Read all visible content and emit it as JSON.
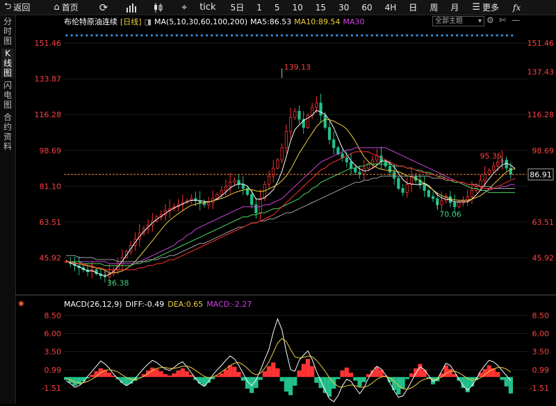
{
  "toolbar": {
    "back_label": "返回",
    "home_label": "首页",
    "tick_label": "tick",
    "periods": [
      "5日",
      "1",
      "5",
      "10",
      "15",
      "30",
      "60",
      "4H",
      "日",
      "周",
      "月"
    ],
    "more_label": "更多",
    "fx_label": "fx"
  },
  "sidebar": {
    "tabs": [
      "分时图",
      "K线图",
      "闪电图",
      "合约资料"
    ],
    "active": "K线图"
  },
  "header": {
    "instrument": "布伦特原油连续",
    "period": "[日线]",
    "ma_params": "MA(5,10,30,60,100,200)",
    "ma5": "MA5:86.53",
    "ma10": "MA10:89.54",
    "ma30": "MA30",
    "theme": "全部主题"
  },
  "macd_header": {
    "params": "MACD(26,12,9)",
    "diff": "DIFF:-0.49",
    "dea": "DEA:0.65",
    "macd": "MACD:-2.27"
  },
  "colors": {
    "up": "#ff3333",
    "down": "#22c08a",
    "ma5": "#ffffff",
    "ma10": "#f0d040",
    "ma30": "#cc44dd",
    "ma60": "#4cd964",
    "ma100": "#a0a0a0",
    "ma200": "#ff3030",
    "axis_text": "#ff4040",
    "label_red": "#ff4040",
    "label_green": "#3bd27a",
    "current_price_line": "#ff8a30"
  },
  "chart_data": [
    {
      "type": "line",
      "title": "布伦特原油连续",
      "subtitle": "日线",
      "y_ticks": [
        151.46,
        133.87,
        116.28,
        98.69,
        81.1,
        63.51,
        45.92
      ],
      "ylim": [
        30,
        158
      ],
      "right_axis_labels": [
        "151.46",
        "137.43",
        "116.28",
        "98.69",
        "86.91",
        "63.51",
        "45.92"
      ],
      "current_price": 86.91,
      "annotations": [
        {
          "text": "139.13",
          "value": 139.13,
          "kind": "high"
        },
        {
          "text": "36.38",
          "value": 36.38,
          "kind": "low"
        },
        {
          "text": "70.06",
          "value": 70.06,
          "kind": "low"
        },
        {
          "text": "95.35",
          "value": 95.35,
          "kind": "high"
        }
      ],
      "close_series": [
        44,
        43,
        42,
        41,
        40,
        39,
        40,
        38,
        37,
        36.5,
        38,
        40,
        43,
        46,
        49,
        52,
        55,
        58,
        60,
        62,
        64,
        66,
        67,
        69,
        70,
        71,
        72,
        73,
        74,
        75,
        74,
        73,
        72,
        73,
        75,
        77,
        79,
        81,
        83,
        84,
        82,
        80,
        77,
        72,
        68,
        75,
        82,
        86,
        90,
        94,
        100,
        108,
        115,
        118,
        114,
        110,
        116,
        120,
        122,
        116,
        110,
        104,
        100,
        97,
        95,
        93,
        90,
        88,
        87,
        90,
        92,
        94,
        96,
        93,
        91,
        88,
        85,
        80,
        78,
        82,
        86,
        84,
        82,
        79,
        76,
        75,
        72,
        74,
        76,
        73,
        71,
        73,
        74,
        76,
        79,
        81,
        84,
        87,
        89,
        91,
        93,
        94,
        90,
        87
      ],
      "ma_series": [
        {
          "name": "MA5",
          "values": [
            44.4,
            43.4,
            42.4,
            41.4,
            40.4,
            39.4,
            39.6,
            38.6,
            37.6,
            37.1,
            37.6,
            39.2,
            41.5,
            44.2,
            47.3,
            50.4,
            53.4,
            56.4,
            58.8,
            61,
            63,
            64.8,
            66.2,
            67.8,
            69.2,
            70.4,
            71.4,
            72.4,
            73.4,
            74.2,
            74.2,
            74,
            73.6,
            73.4,
            73.8,
            75,
            76.4,
            78.2,
            80.2,
            81.6,
            82.2,
            82.2,
            81.2,
            78.4,
            74.8,
            74.6,
            75.6,
            77.2,
            79.4,
            83.4,
            88.4,
            95.6,
            103.4,
            109,
            111.2,
            113.4,
            114.6,
            116,
            118.4,
            117.6,
            116.4,
            113.6,
            109.8,
            104.8,
            99.8,
            96.6,
            93.6,
            91.4,
            89.6,
            88.6,
            88.8,
            90,
            91.4,
            93.4,
            93.6,
            92.4,
            90.6,
            87.4,
            84.4,
            82.6,
            82.2,
            82,
            81.8,
            82.6,
            81.4,
            79.2,
            76.8,
            75.4,
            74.6,
            74.4,
            73.4,
            73.4,
            73.4,
            73.4,
            74.8,
            76.8,
            79.2,
            82,
            84.8,
            87.4,
            89.6,
            91.6,
            92.4,
            91.4,
            89.8
          ]
        },
        {
          "name": "MA10",
          "values": [
            44.4,
            43.9,
            43.4,
            42.9,
            42.4,
            41.9,
            41.4,
            40.9,
            40.4,
            39.8,
            38.5,
            38.6,
            38.8,
            39.4,
            40.6,
            42.1,
            44.1,
            46.5,
            49.1,
            51.7,
            54.3,
            57,
            59.7,
            62.3,
            64.4,
            66,
            67.6,
            69.1,
            70.5,
            71.7,
            72.3,
            72.7,
            73.1,
            73.4,
            73.9,
            74.5,
            75.1,
            75.8,
            76.9,
            77.9,
            78.6,
            79.2,
            79.6,
            79.4,
            78.8,
            78.5,
            78.8,
            79.8,
            80.9,
            82,
            83.8,
            86.1,
            89.3,
            93.3,
            97.3,
            100.6,
            104.1,
            107.2,
            110.4,
            112.6,
            114,
            113.8,
            113.1,
            112,
            110.9,
            109.2,
            106.4,
            103.2,
            99.2,
            95.6,
            93.3,
            91.6,
            90.2,
            89.4,
            89,
            88.9,
            88.6,
            88.2,
            87.4,
            86.2,
            85.7,
            84.9,
            83.9,
            82.3,
            80.8,
            79.3,
            77.6,
            76.5,
            75.7,
            74.9,
            74.4,
            74.2,
            74.2,
            74.3,
            74.7,
            75.5,
            76.5,
            78,
            79.8,
            82,
            84.1,
            86.2,
            88.2,
            89.3,
            89.6
          ]
        },
        {
          "name": "MA30",
          "values": [
            44,
            44,
            44,
            44,
            44,
            44,
            44,
            44,
            44,
            44,
            43,
            43,
            43,
            43,
            43,
            43,
            43,
            44,
            45,
            46,
            47,
            48,
            49,
            50,
            51,
            52,
            54,
            55,
            57,
            58,
            60,
            61,
            62,
            63,
            64,
            65,
            66,
            67,
            68,
            69,
            70,
            71,
            71,
            71,
            71,
            71,
            72,
            72,
            73,
            74,
            75,
            77,
            79,
            81,
            83,
            85,
            87,
            89,
            91,
            93,
            94,
            95,
            96,
            97,
            98,
            99,
            99,
            100,
            100,
            100,
            100,
            100,
            100,
            100,
            100,
            99,
            98,
            97,
            96,
            95,
            94,
            93,
            92,
            91,
            90,
            89,
            88,
            87,
            86,
            85,
            84,
            83,
            82,
            81,
            80,
            80,
            79,
            79,
            79,
            80,
            80,
            81,
            81,
            82,
            82
          ]
        },
        {
          "name": "MA60",
          "values": [
            44,
            44,
            44,
            44,
            43,
            43,
            43,
            43,
            43,
            42,
            42,
            42,
            42,
            42,
            42,
            42,
            43,
            43,
            44,
            44,
            45,
            46,
            47,
            48,
            49,
            50,
            51,
            52,
            53,
            54,
            55,
            56,
            57,
            58,
            59,
            60,
            61,
            62,
            63,
            64,
            65,
            66,
            66,
            67,
            67,
            68,
            68,
            69,
            70,
            70,
            71,
            72,
            73,
            74,
            75,
            77,
            78,
            80,
            81,
            83,
            84,
            85,
            86,
            87,
            88,
            89,
            90,
            90,
            91,
            91,
            92,
            92,
            92,
            92,
            92,
            92,
            91,
            91,
            91,
            90,
            90,
            89,
            89,
            88,
            88,
            87,
            86,
            86,
            85,
            84,
            83,
            83,
            82,
            81,
            80,
            80,
            79,
            79,
            78,
            78,
            78,
            78,
            78,
            78,
            78
          ]
        },
        {
          "name": "MA100",
          "values": [
            47,
            47,
            47,
            46,
            46,
            46,
            46,
            45,
            45,
            45,
            45,
            45,
            44,
            44,
            44,
            44,
            44,
            44,
            44,
            45,
            45,
            45,
            46,
            46,
            47,
            47,
            48,
            49,
            50,
            51,
            52,
            53,
            53,
            54,
            55,
            56,
            57,
            58,
            59,
            60,
            61,
            61,
            62,
            63,
            63,
            64,
            64,
            65,
            65,
            66,
            67,
            68,
            68,
            69,
            70,
            71,
            72,
            73,
            74,
            75,
            76,
            77,
            78,
            79,
            80,
            81,
            82,
            83,
            83,
            84,
            84,
            85,
            85,
            86,
            86,
            86,
            86,
            86,
            86,
            86,
            86,
            86,
            86,
            86,
            86,
            85,
            85,
            85,
            84,
            84,
            84,
            83,
            83,
            82,
            82,
            82,
            81,
            81,
            81,
            80,
            80,
            80,
            80,
            80,
            80
          ]
        },
        {
          "name": "MA200",
          "values": [
            44,
            44,
            43,
            43,
            43,
            42,
            42,
            41,
            41,
            40,
            40,
            40,
            40,
            40,
            40,
            40,
            40,
            41,
            41,
            42,
            42,
            43,
            43,
            44,
            45,
            45,
            46,
            47,
            48,
            49,
            50,
            51,
            52,
            53,
            54,
            55,
            56,
            57,
            58,
            59,
            60,
            61,
            62,
            63,
            63,
            64,
            65,
            66,
            67,
            69,
            71,
            73,
            75,
            77,
            79,
            81,
            83,
            85,
            87,
            89,
            90,
            92,
            93,
            94,
            95,
            96,
            97,
            98,
            98,
            98,
            98,
            97,
            96,
            95,
            94,
            93,
            92,
            91,
            91,
            90,
            90,
            89,
            88,
            88,
            87,
            87,
            86,
            85,
            85,
            84,
            84,
            83,
            83,
            82,
            82,
            81,
            81,
            80,
            80,
            80,
            81,
            82,
            83,
            84,
            85
          ]
        }
      ]
    },
    {
      "type": "bar",
      "title": "MACD(26,12,9)",
      "y_ticks": [
        8.5,
        6.0,
        3.5,
        0.99,
        -1.51
      ],
      "ylim": [
        -3.8,
        9.2
      ],
      "macd_histogram": [
        -0.4,
        -0.8,
        -1.2,
        -1.0,
        -0.6,
        -0.2,
        0.3,
        0.8,
        1.2,
        1.0,
        0.6,
        0.2,
        -0.3,
        -0.8,
        -1.1,
        -0.9,
        -0.5,
        -0.1,
        0.4,
        0.9,
        1.3,
        1.1,
        0.8,
        0.4,
        0.2,
        0.5,
        0.9,
        1.2,
        0.8,
        0.3,
        -0.4,
        -0.9,
        -1.2,
        -0.8,
        -0.3,
        0.2,
        0.5,
        1.0,
        1.6,
        1.4,
        0.7,
        -0.5,
        -1.6,
        -2.2,
        -1.5,
        -0.4,
        0.8,
        1.5,
        2.0,
        1.2,
        -0.6,
        -2.0,
        -2.5,
        -1.2,
        0.9,
        1.8,
        2.5,
        1.5,
        -0.8,
        -1.5,
        -2.2,
        -2.7,
        -1.6,
        -0.3,
        0.9,
        1.3,
        0.6,
        -0.5,
        -1.3,
        -0.7,
        0.4,
        0.9,
        1.4,
        1.0,
        0.2,
        -0.7,
        -1.8,
        -2.4,
        -1.6,
        -0.3,
        0.5,
        1.2,
        1.8,
        1.0,
        -0.2,
        -1.0,
        -0.6,
        0.5,
        1.6,
        1.1,
        0.4,
        -0.5,
        -1.5,
        -2.1,
        -1.3,
        -0.4,
        0.6,
        1.1,
        1.6,
        1.2,
        0.7,
        -0.4,
        -1.3,
        -2.27
      ],
      "diff_series": [
        -0.5,
        -0.9,
        -1.4,
        -1.2,
        -0.7,
        0.1,
        0.8,
        1.5,
        2.2,
        1.8,
        1.2,
        0.4,
        -0.2,
        -0.8,
        -1.2,
        -0.8,
        -0.2,
        0.5,
        1.2,
        1.8,
        2.3,
        2.0,
        1.5,
        1.1,
        0.9,
        1.3,
        1.8,
        2.1,
        1.4,
        0.6,
        -0.2,
        -0.9,
        -1.3,
        -0.6,
        0.3,
        1.0,
        1.6,
        2.3,
        2.9,
        2.5,
        1.6,
        0.5,
        -0.6,
        -1.2,
        -0.4,
        0.9,
        2.4,
        3.8,
        6.2,
        8.0,
        6.5,
        3.5,
        1.0,
        0.8,
        2.3,
        3.0,
        3.6,
        2.4,
        0.8,
        -0.5,
        -1.8,
        -3.0,
        -3.4,
        -2.6,
        -1.2,
        -0.3,
        -0.6,
        -1.5,
        -2.3,
        -1.5,
        -0.2,
        0.8,
        1.5,
        1.1,
        0.3,
        -0.8,
        -1.9,
        -2.8,
        -2.6,
        -1.7,
        -0.6,
        0.5,
        1.4,
        1.0,
        0.2,
        -0.6,
        -0.3,
        0.8,
        1.9,
        1.6,
        0.7,
        -0.3,
        -1.2,
        -1.8,
        -1.2,
        -0.3,
        0.8,
        1.6,
        2.3,
        2.1,
        1.6,
        0.9,
        0.2,
        -0.49
      ],
      "dea_series": [
        -0.2,
        -0.4,
        -0.7,
        -0.8,
        -0.8,
        -0.6,
        -0.3,
        0.1,
        0.6,
        0.9,
        1.0,
        0.9,
        0.7,
        0.3,
        -0.1,
        -0.3,
        -0.4,
        -0.2,
        0.1,
        0.5,
        0.9,
        1.2,
        1.3,
        1.3,
        1.2,
        1.2,
        1.3,
        1.5,
        1.5,
        1.3,
        0.9,
        0.5,
        0.1,
        -0.1,
        0.0,
        0.3,
        0.7,
        1.1,
        1.6,
        1.9,
        2.0,
        1.7,
        1.2,
        0.6,
        0.3,
        0.5,
        1.2,
        2.1,
        3.4,
        4.7,
        5.3,
        4.9,
        3.8,
        2.8,
        2.6,
        2.7,
        2.9,
        2.8,
        2.3,
        1.6,
        0.8,
        -0.1,
        -0.8,
        -1.3,
        -1.4,
        -1.2,
        -1.1,
        -1.2,
        -1.4,
        -1.4,
        -1.2,
        -0.8,
        -0.3,
        0.0,
        0.1,
        -0.1,
        -0.6,
        -1.2,
        -1.6,
        -1.7,
        -1.5,
        -1.1,
        -0.6,
        -0.3,
        -0.2,
        -0.3,
        -0.3,
        0.0,
        0.5,
        0.8,
        0.8,
        0.6,
        0.2,
        -0.2,
        -0.4,
        -0.4,
        -0.1,
        0.3,
        0.8,
        1.1,
        1.3,
        1.3,
        1.1,
        0.65
      ]
    }
  ]
}
